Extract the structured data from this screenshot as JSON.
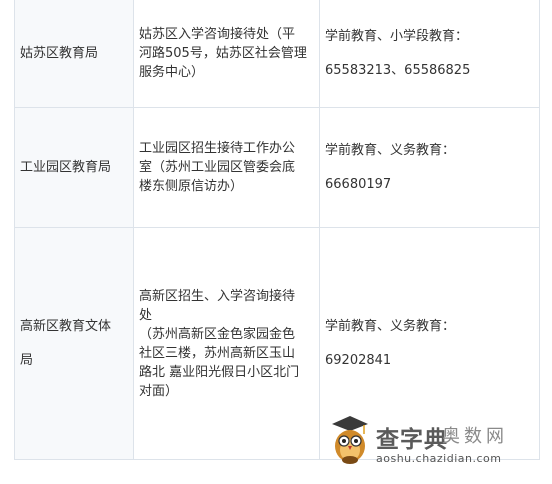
{
  "rows": [
    {
      "bureau": "姑苏区教育局",
      "office_lines": [
        "姑苏区入学咨询接待处（平",
        "河路505号，姑苏区社会管理",
        "服务中心）"
      ],
      "contact_label": "学前教育、小学段教育：",
      "phones": "65583213、65586825"
    },
    {
      "bureau": "工业园区教育局",
      "office_lines": [
        "工业园区招生接待工作办公",
        "室（苏州工业园区管委会底",
        "楼东侧原信访办）"
      ],
      "contact_label": "学前教育、义务教育：",
      "phones": "66680197"
    },
    {
      "bureau_lines": [
        "高新区教育文体",
        "局"
      ],
      "office_lines": [
        "高新区招生、入学咨询接待",
        "处",
        "（苏州高新区金色家园金色",
        "社区三楼，苏州高新区玉山",
        "路北 嘉业阳光假日小区北门",
        "对面）"
      ],
      "contact_label": "学前教育、义务教育：",
      "phones": "69202841"
    }
  ],
  "watermark": {
    "brand": "查字典",
    "sub": "奥数网",
    "url": "aoshu.chazidian.com"
  },
  "colors": {
    "border": "#dde3ea",
    "text": "#333333",
    "first_col_bg": "#f7f9fb"
  }
}
